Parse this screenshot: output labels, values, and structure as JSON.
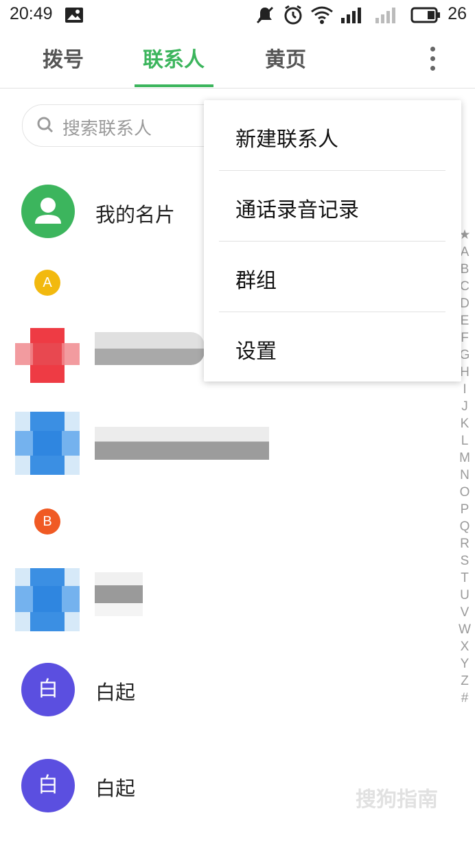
{
  "status_bar": {
    "time": "20:49",
    "battery": "26"
  },
  "tabs": [
    {
      "label": "拨号",
      "active": false
    },
    {
      "label": "联系人",
      "active": true
    },
    {
      "label": "黄页",
      "active": false
    }
  ],
  "search": {
    "placeholder": "搜索联系人"
  },
  "my_card": {
    "label": "我的名片"
  },
  "sections": [
    {
      "letter": "A",
      "color": "#f2b90f"
    },
    {
      "letter": "B",
      "color": "#f05a24"
    }
  ],
  "contacts": [
    {
      "name": "白起",
      "avatar_text": "白",
      "avatar_color": "#5b4fe0"
    },
    {
      "name": "白起",
      "avatar_text": "白",
      "avatar_color": "#5b4fe0"
    }
  ],
  "menu": {
    "items": [
      {
        "label": "新建联系人"
      },
      {
        "label": "通话录音记录"
      },
      {
        "label": "群组"
      },
      {
        "label": "设置"
      }
    ]
  },
  "index_bar": [
    "★",
    "A",
    "B",
    "C",
    "D",
    "E",
    "F",
    "G",
    "H",
    "I",
    "J",
    "K",
    "L",
    "M",
    "N",
    "O",
    "P",
    "Q",
    "R",
    "S",
    "T",
    "U",
    "V",
    "W",
    "X",
    "Y",
    "Z",
    "#"
  ],
  "colors": {
    "accent": "#3cb55d",
    "my_card_avatar": "#3cb55d"
  },
  "watermark": "搜狗指南"
}
